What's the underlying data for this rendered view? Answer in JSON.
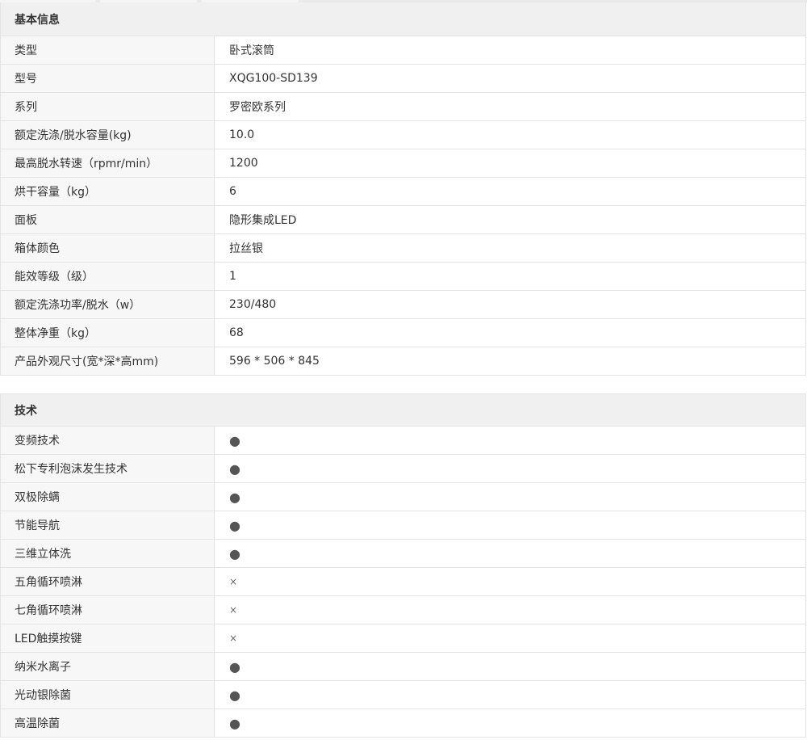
{
  "basic": {
    "title": "基本信息",
    "rows": [
      {
        "label": "类型",
        "value": "卧式滚筒"
      },
      {
        "label": "型号",
        "value": "XQG100-SD139"
      },
      {
        "label": "系列",
        "value": "罗密欧系列"
      },
      {
        "label": "额定洗涤/脱水容量(kg)",
        "value": "10.0"
      },
      {
        "label": "最高脱水转速（rpmr/min）",
        "value": "1200"
      },
      {
        "label": "烘干容量（kg）",
        "value": "6"
      },
      {
        "label": "面板",
        "value": "隐形集成LED"
      },
      {
        "label": "箱体颜色",
        "value": "拉丝银"
      },
      {
        "label": "能效等级（级）",
        "value": "1"
      },
      {
        "label": "额定洗涤功率/脱水（w）",
        "value": "230/480"
      },
      {
        "label": "整体净重（kg）",
        "value": "68"
      },
      {
        "label": "产品外观尺寸(宽*深*高mm)",
        "value": "596 * 506 * 845"
      }
    ]
  },
  "tech": {
    "title": "技术",
    "rows": [
      {
        "label": "变频技术",
        "value": "●"
      },
      {
        "label": "松下专利泡沫发生技术",
        "value": "●"
      },
      {
        "label": "双极除螨",
        "value": "●"
      },
      {
        "label": "节能导航",
        "value": "●"
      },
      {
        "label": "三维立体洗",
        "value": "●"
      },
      {
        "label": "五角循环喷淋",
        "value": "×"
      },
      {
        "label": "七角循环喷淋",
        "value": "×"
      },
      {
        "label": "LED触摸按键",
        "value": "×"
      },
      {
        "label": "纳米水离子",
        "value": "●"
      },
      {
        "label": "光动银除菌",
        "value": "●"
      },
      {
        "label": "高温除菌",
        "value": "●"
      }
    ]
  }
}
